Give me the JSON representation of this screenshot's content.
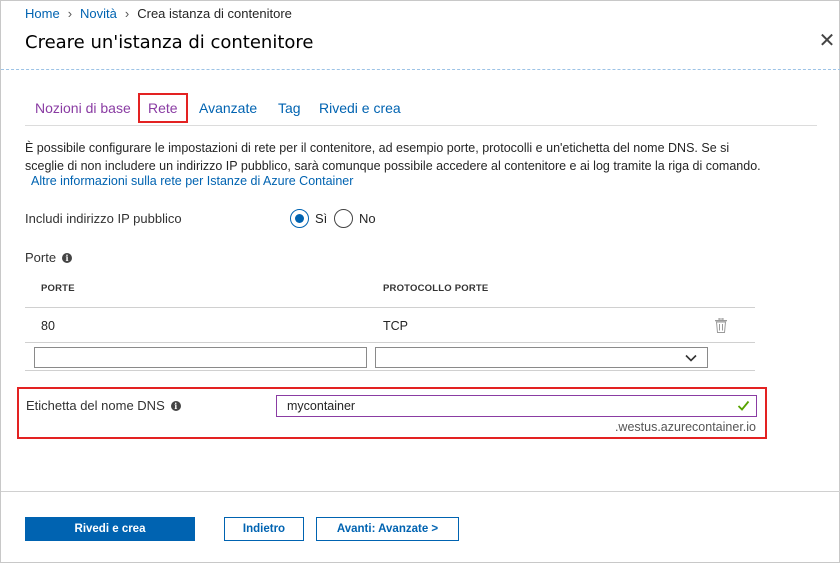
{
  "breadcrumb": {
    "home": "Home",
    "new": "Novità",
    "current": "Crea istanza di contenitore"
  },
  "page_title": "Creare un'istanza di contenitore",
  "close_symbol": "✕",
  "tabs": [
    {
      "label": "Nozioni di base",
      "state": "visited"
    },
    {
      "label": "Rete",
      "state": "active"
    },
    {
      "label": "Avanzate",
      "state": "normal"
    },
    {
      "label": "Tag",
      "state": "normal"
    },
    {
      "label": "Rivedi e crea",
      "state": "normal"
    }
  ],
  "description": {
    "line1": "È possibile configurare le impostazioni di rete per il contenitore, ad esempio porte, protocolli e un'etichetta del nome DNS. Se si",
    "line2": "sceglie di non includere un indirizzo IP pubblico, sarà comunque possibile accedere al contenitore e ai log tramite la riga di comando.",
    "link": "Altre informazioni sulla rete per Istanze di Azure Container"
  },
  "public_ip": {
    "label": "Includi indirizzo IP pubblico",
    "options": [
      "Sì",
      "No"
    ],
    "selected": "Sì"
  },
  "ports": {
    "label": "Porte",
    "info_symbol": "i",
    "columns": [
      "PORTE",
      "PROTOCOLLO PORTE"
    ],
    "rows": [
      {
        "port": "80",
        "protocol": "TCP"
      }
    ],
    "new_port_value": "",
    "new_protocol_value": ""
  },
  "dns": {
    "label": "Etichetta del nome DNS",
    "value": "mycontainer",
    "suffix": ".westus.azurecontainer.io"
  },
  "buttons": {
    "review_create": "Rivedi e crea",
    "back": "Indietro",
    "next": "Avanti: Avanzate >"
  },
  "colors": {
    "accent": "#0063b1",
    "visited": "#8a3ca3",
    "highlight": "#e32222",
    "valid": "#57a300"
  }
}
